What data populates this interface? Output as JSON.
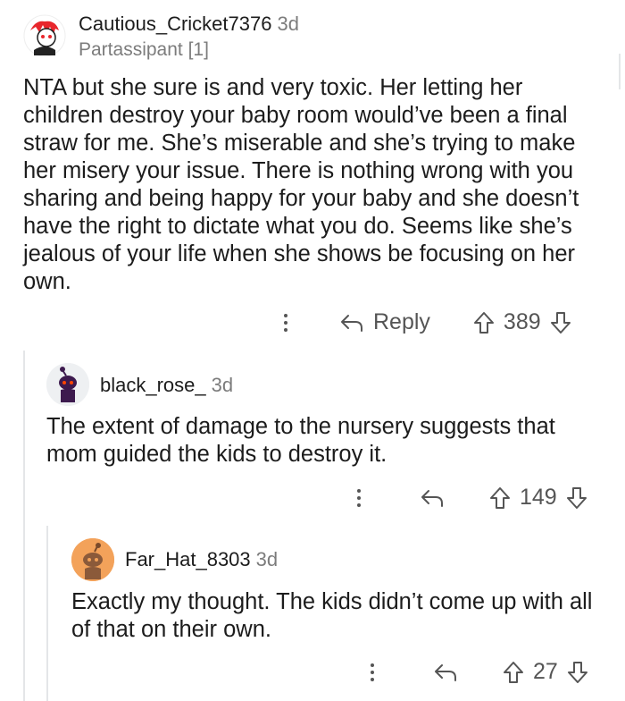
{
  "comments": [
    {
      "author": "Cautious_Cricket7376",
      "time": "3d",
      "flair": "Partassipant [1]",
      "body": "NTA but she sure is and very toxic. Her letting her children destroy your baby room would’ve been a final straw for me. She’s miserable and she’s trying to make her misery your issue. There is nothing wrong with you sharing and being happy for your baby and she doesn’t have the right to dictate what you do. Seems like she’s jealous of your life when she shows be focusing on her own.",
      "reply_label": "Reply",
      "score": "389",
      "avatar_icon": "snoo-avatar-red"
    },
    {
      "author": "black_rose_",
      "time": "3d",
      "body": "The extent of damage to the nursery suggests that mom guided the kids to destroy it.",
      "score": "149",
      "avatar_icon": "snoo-avatar-purple"
    },
    {
      "author": "Far_Hat_8303",
      "time": "3d",
      "body": "Exactly my thought. The kids didn’t come up with all of that on their own.",
      "score": "27",
      "avatar_icon": "snoo-avatar-orange"
    }
  ],
  "colors": {
    "text": "#1c1c1c",
    "meta": "#7c7c7c",
    "icon": "#555555",
    "thread_line": "#e4e6e8",
    "avatar_red": "#e8262c",
    "avatar_purple": "#3d1a4e",
    "avatar_orange": "#f3a25a"
  }
}
